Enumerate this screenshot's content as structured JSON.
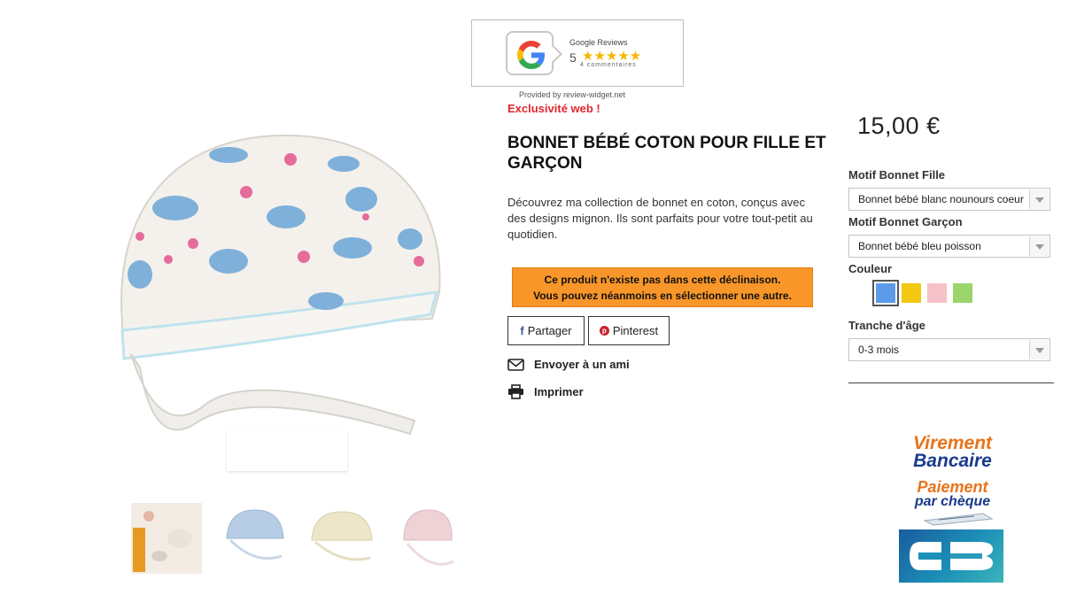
{
  "review_widget": {
    "title": "Google Reviews",
    "rating": "5",
    "stars": "★★★★★",
    "count": "4 commentaires",
    "provided": "Provided by review-widget.net"
  },
  "product": {
    "badge": "Exclusivité web !",
    "title": "BONNET BÉBÉ COTON POUR FILLE ET GARÇON",
    "description": "Découvrez ma collection de bonnet en coton, conçus avec des designs mignon. Ils sont parfaits pour votre tout-petit au quotidien.",
    "warning_line1": "Ce produit n'existe pas dans cette déclinaison.",
    "warning_line2": "Vous pouvez néanmoins en sélectionner une autre.",
    "share_facebook": "Partager",
    "share_pinterest": "Pinterest",
    "send_friend": "Envoyer à un ami",
    "print": "Imprimer"
  },
  "options": {
    "price": "15,00 €",
    "motif_fille_label": "Motif Bonnet Fille",
    "motif_fille_value": "Bonnet bébé blanc nounours coeur",
    "motif_garcon_label": "Motif Bonnet Garçon",
    "motif_garcon_value": "Bonnet bébé bleu poisson",
    "couleur_label": "Couleur",
    "colors": [
      "#5b9bea",
      "#f2c811",
      "#f6c1c8",
      "#9ad66c"
    ],
    "tranche_label": "Tranche d'âge",
    "tranche_value": "0-3 mois"
  },
  "payment": {
    "virement_line1": "Virement",
    "virement_line2": "Bancaire",
    "cheque_line1": "Paiement",
    "cheque_line2": "par chèque"
  }
}
